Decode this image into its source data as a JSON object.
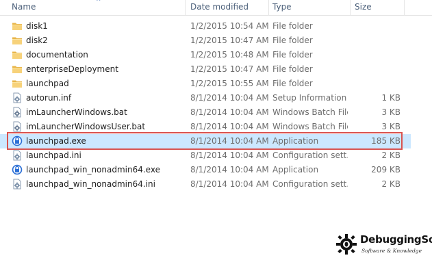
{
  "columns": {
    "name": "Name",
    "date": "Date modified",
    "type": "Type",
    "size": "Size"
  },
  "sort_indicator": "^",
  "files": [
    {
      "name": "disk1",
      "date": "1/2/2015 10:54 AM",
      "type": "File folder",
      "size": "",
      "icon": "folder-icon"
    },
    {
      "name": "disk2",
      "date": "1/2/2015 10:47 AM",
      "type": "File folder",
      "size": "",
      "icon": "folder-icon"
    },
    {
      "name": "documentation",
      "date": "1/2/2015 10:48 AM",
      "type": "File folder",
      "size": "",
      "icon": "folder-icon"
    },
    {
      "name": "enterpriseDeployment",
      "date": "1/2/2015 10:47 AM",
      "type": "File folder",
      "size": "",
      "icon": "folder-icon"
    },
    {
      "name": "launchpad",
      "date": "1/2/2015 10:55 AM",
      "type": "File folder",
      "size": "",
      "icon": "folder-icon"
    },
    {
      "name": "autorun.inf",
      "date": "8/1/2014 10:04 AM",
      "type": "Setup Information",
      "size": "1 KB",
      "icon": "settings-file-icon"
    },
    {
      "name": "imLauncherWindows.bat",
      "date": "8/1/2014 10:04 AM",
      "type": "Windows Batch File",
      "size": "3 KB",
      "icon": "batch-file-icon"
    },
    {
      "name": "imLauncherWindowsUser.bat",
      "date": "8/1/2014 10:04 AM",
      "type": "Windows Batch File",
      "size": "3 KB",
      "icon": "batch-file-icon"
    },
    {
      "name": "launchpad.exe",
      "date": "8/1/2014 10:04 AM",
      "type": "Application",
      "size": "185 KB",
      "icon": "installer-app-icon",
      "selected": true
    },
    {
      "name": "launchpad.ini",
      "date": "8/1/2014 10:04 AM",
      "type": "Configuration sett...",
      "size": "2 KB",
      "icon": "settings-file-icon"
    },
    {
      "name": "launchpad_win_nonadmin64.exe",
      "date": "8/1/2014 10:04 AM",
      "type": "Application",
      "size": "209 KB",
      "icon": "installer-app-icon"
    },
    {
      "name": "launchpad_win_nonadmin64.ini",
      "date": "8/1/2014 10:04 AM",
      "type": "Configuration sett...",
      "size": "2 KB",
      "icon": "settings-file-icon"
    }
  ],
  "watermark": {
    "title": "DebuggingSoft",
    "subtitle": "Software & Knowledge"
  },
  "colors": {
    "selection": "#cce8ff",
    "highlight_border": "#d9534f",
    "folder": "#f3c25a"
  }
}
